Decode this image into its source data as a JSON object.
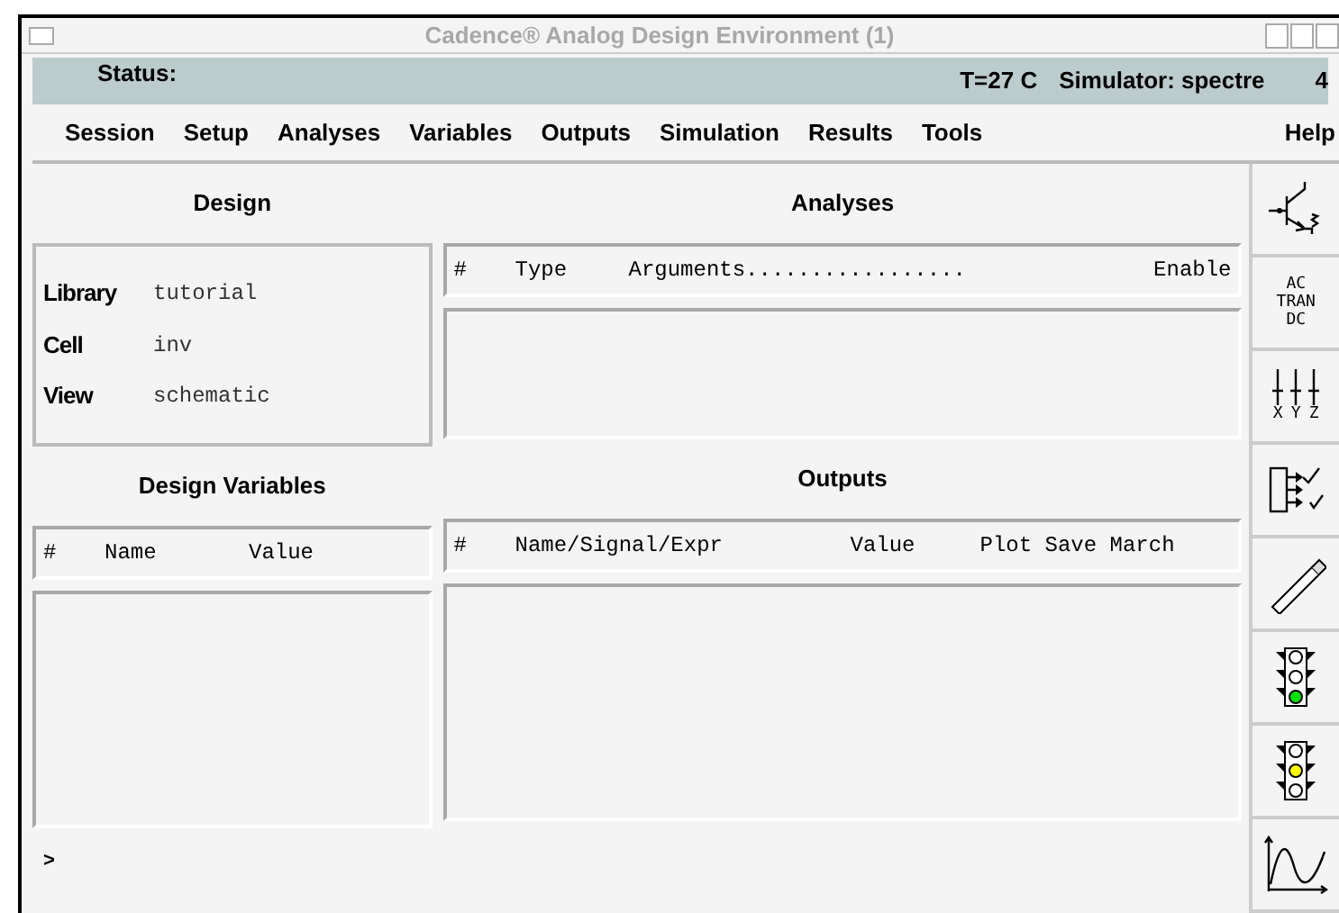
{
  "window": {
    "title": "Cadence® Analog Design Environment (1)"
  },
  "status_bar": {
    "label": "Status:",
    "temperature": "T=27 C",
    "simulator": "Simulator: spectre",
    "extra": "4"
  },
  "menu": [
    "Session",
    "Setup",
    "Analyses",
    "Variables",
    "Outputs",
    "Simulation",
    "Results",
    "Tools"
  ],
  "help_menu": "Help",
  "design": {
    "heading": "Design",
    "fields": [
      {
        "label": "Library",
        "value": "tutorial"
      },
      {
        "label": "Cell",
        "value": "inv"
      },
      {
        "label": "View",
        "value": "schematic"
      }
    ]
  },
  "analyses": {
    "heading": "Analyses",
    "columns": [
      "#",
      "Type",
      "Arguments.................",
      "Enable"
    ]
  },
  "design_variables": {
    "heading": "Design Variables",
    "columns": [
      "#",
      "Name",
      "Value"
    ]
  },
  "outputs": {
    "heading": "Outputs",
    "columns": [
      "#",
      "Name/Signal/Expr",
      "Value",
      "Plot Save March"
    ]
  },
  "prompt": ">",
  "toolbar": [
    {
      "kind": "transistor"
    },
    {
      "kind": "analyses",
      "labels": [
        "AC",
        "TRAN",
        "DC"
      ]
    },
    {
      "kind": "sliders",
      "labels": [
        "X",
        "Y",
        "Z"
      ]
    },
    {
      "kind": "outputs"
    },
    {
      "kind": "pen"
    },
    {
      "kind": "traffic",
      "color": "#00e000"
    },
    {
      "kind": "traffic",
      "color": "#ffff00"
    },
    {
      "kind": "waveform"
    }
  ]
}
